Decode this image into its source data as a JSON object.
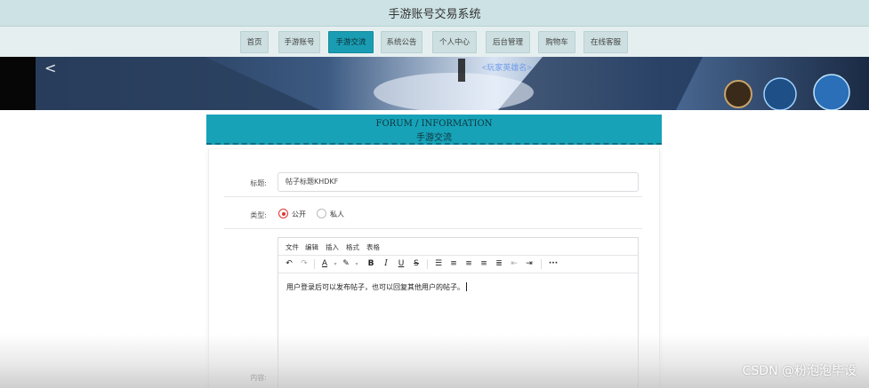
{
  "site": {
    "title": "手游账号交易系统"
  },
  "nav": {
    "items": [
      {
        "label": "首页"
      },
      {
        "label": "手游账号"
      },
      {
        "label": "手游交流",
        "active": true
      },
      {
        "label": "系统公告"
      },
      {
        "label": "个人中心"
      },
      {
        "label": "后台管理"
      },
      {
        "label": "购物车"
      },
      {
        "label": "在线客服"
      }
    ]
  },
  "banner": {
    "overlay_text": "<玩家英雄名>"
  },
  "forum": {
    "title_en": "FORUM / INFORMATION",
    "title_cn": "手游交流"
  },
  "form": {
    "title_label": "标题:",
    "title_value": "帖子标题KHDKF",
    "type_label": "类型:",
    "type_options": [
      {
        "label": "公开",
        "checked": true
      },
      {
        "label": "私人",
        "checked": false
      }
    ],
    "content_label": "内容:"
  },
  "editor": {
    "menus": [
      "文件",
      "编辑",
      "插入",
      "格式",
      "表格"
    ],
    "toolbar_icons": [
      "undo-icon",
      "redo-icon",
      "font-color-icon",
      "highlight-icon",
      "bold-icon",
      "italic-icon",
      "underline-icon",
      "strikethrough-icon",
      "bullet-list-icon",
      "align-left-icon",
      "align-center-icon",
      "align-right-icon",
      "align-justify-icon",
      "outdent-icon",
      "indent-icon",
      "more-icon"
    ],
    "content": "用户登录后可以发布帖子，也可以回复其他用户的帖子。"
  },
  "watermark": "CSDN @粉泡泡毕设",
  "colors": {
    "accent": "#17a2b8",
    "topbar": "#cde2e4",
    "radio_checked": "#e0342f"
  }
}
